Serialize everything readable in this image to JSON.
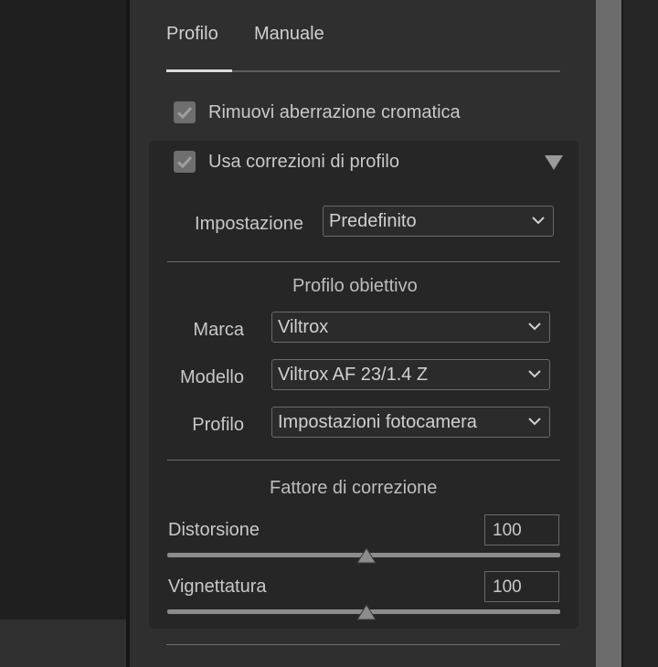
{
  "tabs": [
    {
      "label": "Profilo",
      "active": true
    },
    {
      "label": "Manuale",
      "active": false
    }
  ],
  "chromatic": {
    "label": "Rimuovi aberrazione cromatica",
    "checked": true
  },
  "profile_section": {
    "label": "Usa correzioni di profilo",
    "checked": true,
    "setting": {
      "label": "Impostazione",
      "value": "Predefinito"
    },
    "lens_profile": {
      "title": "Profilo obiettivo",
      "make": {
        "label": "Marca",
        "value": "Viltrox"
      },
      "model": {
        "label": "Modello",
        "value": "Viltrox AF 23/1.4 Z"
      },
      "profile": {
        "label": "Profilo",
        "value": "Impostazioni fotocamera"
      }
    },
    "correction": {
      "title": "Fattore di correzione",
      "distortion": {
        "label": "Distorsione",
        "value": "100",
        "slider_fraction": 0.5
      },
      "vignetting": {
        "label": "Vignettatura",
        "value": "100",
        "slider_fraction": 0.5
      }
    }
  },
  "colors": {
    "accent": "#d9d9d9",
    "panel": "#2f2f2f",
    "section": "#262626"
  },
  "icons": {
    "checkbox": "check-icon",
    "collapse": "triangle-down-icon",
    "select": "chevron-down-icon",
    "slider": "slider-thumb-icon"
  }
}
